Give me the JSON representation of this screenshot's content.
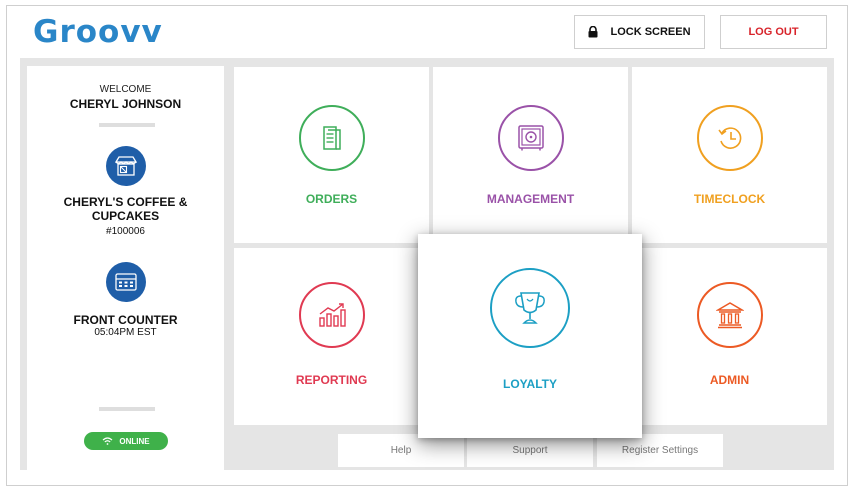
{
  "brand": {
    "name": "Groovv",
    "color": "#2a86c8"
  },
  "header": {
    "lock_label": "LOCK SCREEN",
    "logout_label": "LOG OUT",
    "logout_color": "#d8232a"
  },
  "sidebar": {
    "welcome": "WELCOME",
    "user_name": "CHERYL JOHNSON",
    "store_icon": "store-icon",
    "store_name": "CHERYL'S COFFEE & CUPCAKES",
    "store_number": "#100006",
    "register_icon": "register-icon",
    "register_name": "FRONT COUNTER",
    "time": "05:04PM EST",
    "status_label": "ONLINE",
    "status_color": "#3fb14a"
  },
  "tiles": {
    "orders": {
      "label": "ORDERS",
      "color": "#3fae5a",
      "icon": "receipt-icon"
    },
    "management": {
      "label": "MANAGEMENT",
      "color": "#9a52a8",
      "icon": "safe-icon"
    },
    "timeclock": {
      "label": "TIMECLOCK",
      "color": "#f0a020",
      "icon": "history-clock-icon"
    },
    "reporting": {
      "label": "REPORTING",
      "color": "#e03a52",
      "icon": "bar-chart-icon"
    },
    "loyalty": {
      "label": "LOYALTY",
      "color": "#1c9fc4",
      "icon": "trophy-icon"
    },
    "admin": {
      "label": "ADMIN",
      "color": "#ec5a24",
      "icon": "bank-icon"
    }
  },
  "footer": {
    "help_label": "Help",
    "support_label": "Support",
    "register_settings_label": "Register Settings"
  }
}
